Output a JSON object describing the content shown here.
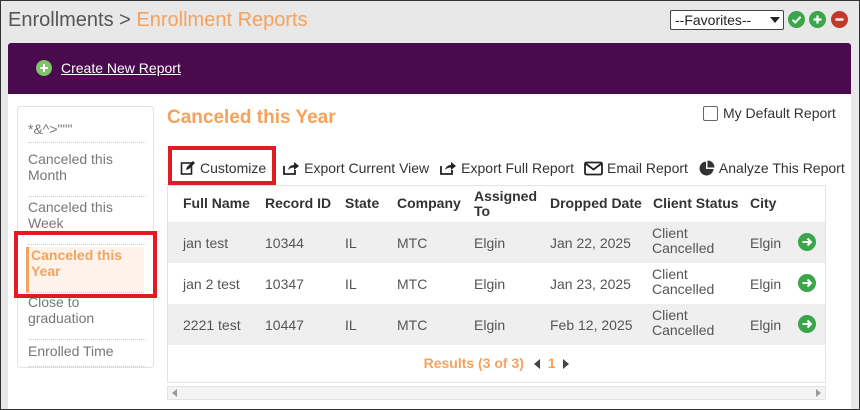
{
  "header": {
    "breadcrumb_root": "Enrollments",
    "breadcrumb_sep": ">",
    "breadcrumb_current": "Enrollment Reports",
    "favorites_value": "--Favorites--"
  },
  "banner": {
    "create_label": "Create New Report"
  },
  "sidebar": {
    "items": [
      {
        "label": "*&^>\"\"\""
      },
      {
        "label": "Canceled this Month"
      },
      {
        "label": "Canceled this Week"
      },
      {
        "label": "Canceled this Year"
      },
      {
        "label": "Close to graduation"
      },
      {
        "label": "Enrolled Time"
      }
    ]
  },
  "report": {
    "title": "Canceled this Year",
    "default_label": "My Default Report"
  },
  "toolbar": {
    "customize": "Customize",
    "export_current": "Export Current View",
    "export_full": "Export Full Report",
    "email": "Email Report",
    "analyze": "Analyze This Report"
  },
  "table": {
    "headers": [
      "Full Name",
      "Record ID",
      "State",
      "Company",
      "Assigned To",
      "Dropped Date",
      "Client Status",
      "City"
    ],
    "rows": [
      [
        "jan test",
        "10344",
        "IL",
        "MTC",
        "Elgin",
        "Jan 22, 2025",
        "Client Cancelled",
        "Elgin"
      ],
      [
        "jan 2 test",
        "10347",
        "IL",
        "MTC",
        "Elgin",
        "Jan 23, 2025",
        "Client Cancelled",
        "Elgin"
      ],
      [
        "2221 test",
        "10447",
        "IL",
        "MTC",
        "Elgin",
        "Feb 12, 2025",
        "Client Cancelled",
        "Elgin"
      ]
    ]
  },
  "pager": {
    "results": "Results (3 of 3)",
    "page": "1"
  },
  "colors": {
    "accent": "#f5a25d",
    "banner": "#4a0a4e",
    "highlight": "#e11b22",
    "go": "#3aa54a"
  }
}
